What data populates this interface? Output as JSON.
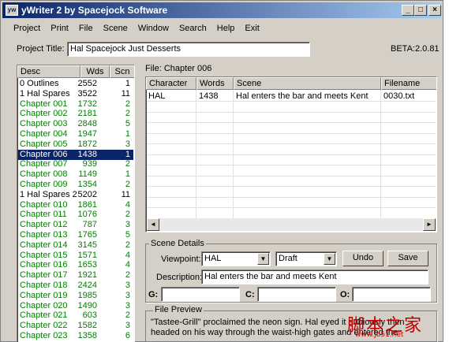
{
  "window": {
    "title": "yWriter 2 by Spacejock Software",
    "icon": "yw",
    "minimize": "_",
    "maximize": "□",
    "close": "×"
  },
  "menu": [
    "Project",
    "Print",
    "File",
    "Scene",
    "Window",
    "Search",
    "Help",
    "Exit"
  ],
  "project": {
    "label": "Project Title:",
    "value": "Hal Spacejock Just Desserts",
    "version": "BETA:2.0.81"
  },
  "chapters": {
    "columns": [
      "Desc",
      "Wds",
      "Scn"
    ],
    "rows": [
      {
        "desc": "0 Outlines",
        "wds": "2552",
        "scn": "1",
        "style": "normal"
      },
      {
        "desc": "1 Hal Spares",
        "wds": "3522",
        "scn": "11",
        "style": "normal"
      },
      {
        "desc": "Chapter 001",
        "wds": "1732",
        "scn": "2",
        "style": "green"
      },
      {
        "desc": "Chapter 002",
        "wds": "2181",
        "scn": "2",
        "style": "green"
      },
      {
        "desc": "Chapter 003",
        "wds": "2848",
        "scn": "5",
        "style": "green"
      },
      {
        "desc": "Chapter 004",
        "wds": "1947",
        "scn": "1",
        "style": "green"
      },
      {
        "desc": "Chapter 005",
        "wds": "1872",
        "scn": "3",
        "style": "green"
      },
      {
        "desc": "Chapter 006",
        "wds": "1438",
        "scn": "1",
        "style": "sel"
      },
      {
        "desc": "Chapter 007",
        "wds": "939",
        "scn": "2",
        "style": "green"
      },
      {
        "desc": "Chapter 008",
        "wds": "1149",
        "scn": "1",
        "style": "green"
      },
      {
        "desc": "Chapter 009",
        "wds": "1354",
        "scn": "2",
        "style": "green"
      },
      {
        "desc": "1 Hal Spares 2",
        "wds": "5202",
        "scn": "11",
        "style": "normal"
      },
      {
        "desc": "Chapter 010",
        "wds": "1861",
        "scn": "4",
        "style": "green"
      },
      {
        "desc": "Chapter 011",
        "wds": "1076",
        "scn": "2",
        "style": "green"
      },
      {
        "desc": "Chapter 012",
        "wds": "787",
        "scn": "3",
        "style": "green"
      },
      {
        "desc": "Chapter 013",
        "wds": "1765",
        "scn": "5",
        "style": "green"
      },
      {
        "desc": "Chapter 014",
        "wds": "3145",
        "scn": "2",
        "style": "green"
      },
      {
        "desc": "Chapter 015",
        "wds": "1571",
        "scn": "4",
        "style": "green"
      },
      {
        "desc": "Chapter 016",
        "wds": "1653",
        "scn": "4",
        "style": "green"
      },
      {
        "desc": "Chapter 017",
        "wds": "1921",
        "scn": "2",
        "style": "green"
      },
      {
        "desc": "Chapter 018",
        "wds": "2424",
        "scn": "3",
        "style": "green"
      },
      {
        "desc": "Chapter 019",
        "wds": "1985",
        "scn": "3",
        "style": "green"
      },
      {
        "desc": "Chapter 020",
        "wds": "1490",
        "scn": "3",
        "style": "green"
      },
      {
        "desc": "Chapter 021",
        "wds": "603",
        "scn": "2",
        "style": "green"
      },
      {
        "desc": "Chapter 022",
        "wds": "1582",
        "scn": "3",
        "style": "green"
      },
      {
        "desc": "Chapter 023",
        "wds": "1358",
        "scn": "6",
        "style": "green"
      }
    ]
  },
  "scenes": {
    "file_label": "File: Chapter 006",
    "columns": [
      "Character",
      "Words",
      "Scene",
      "Filename"
    ],
    "rows": [
      {
        "character": "HAL",
        "words": "1438",
        "scene": "Hal enters the bar and meets Kent",
        "filename": "0030.txt"
      }
    ],
    "scroll_left": "◄",
    "scroll_right": "►"
  },
  "details": {
    "group_label": "Scene Details",
    "viewpoint_label": "Viewpoint:",
    "viewpoint_value": "HAL",
    "status_value": "Draft",
    "undo": "Undo",
    "save": "Save",
    "description_label": "Description:",
    "description_value": "Hal enters the bar and meets Kent",
    "g_label": "G:",
    "c_label": "C:",
    "o_label": "O:"
  },
  "preview": {
    "group_label": "File Preview",
    "text": "\"Tastee-Grill\" proclaimed the neon sign. Hal eyed it dubiously then headed on his way through the waist-high gates and entered the darkened bar beyond."
  },
  "watermark": {
    "text": "脚本之家",
    "url": "www.jb51.net"
  }
}
